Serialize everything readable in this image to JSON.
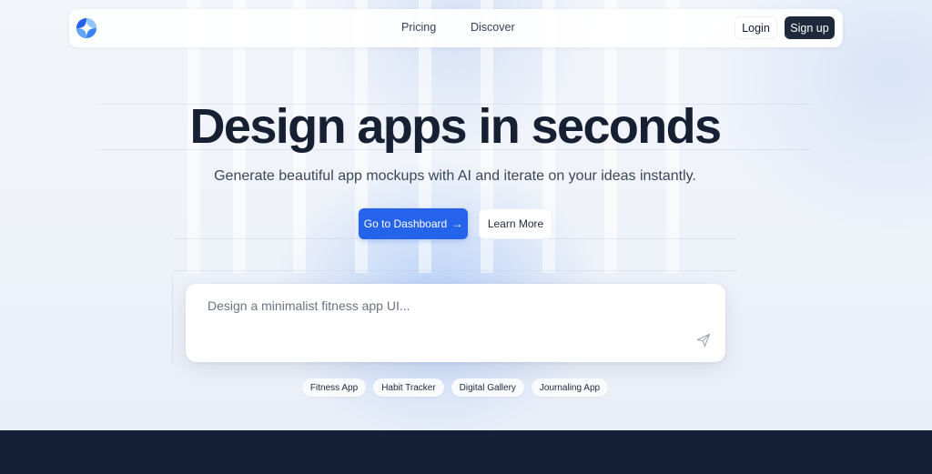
{
  "nav": {
    "links": [
      "Pricing",
      "Discover"
    ],
    "login_label": "Login",
    "signup_label": "Sign up"
  },
  "hero": {
    "title": "Design apps in seconds",
    "subtitle": "Generate beautiful app mockups with AI and iterate on your ideas instantly.",
    "primary_cta": "Go to Dashboard",
    "primary_cta_arrow": "→",
    "secondary_cta": "Learn More"
  },
  "prompt": {
    "placeholder": "Design a minimalist fitness app UI..."
  },
  "suggestions": [
    "Fitness App",
    "Habit Tracker",
    "Digital Gallery",
    "Journaling App"
  ],
  "icons": {
    "logo": "quadrant-logo-icon",
    "send": "send-icon"
  },
  "colors": {
    "accent": "#2563eb",
    "dark": "#1e293b",
    "footer": "#142038"
  }
}
